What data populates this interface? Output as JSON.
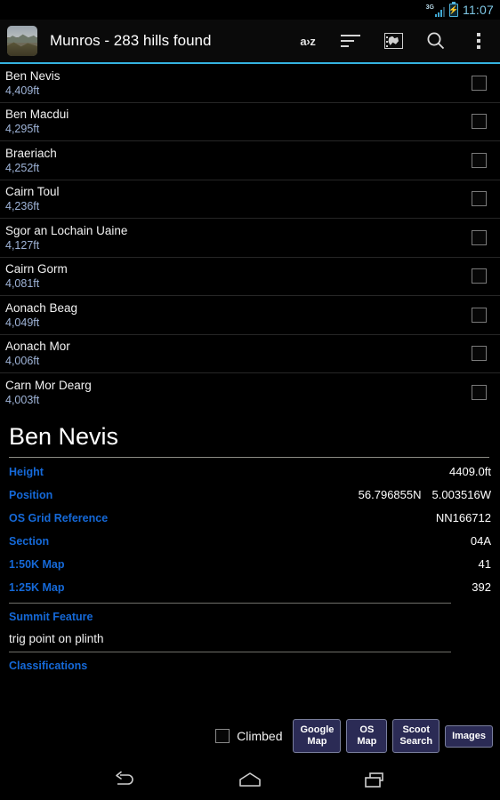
{
  "status_bar": {
    "network": "3G",
    "battery_icon": "battery-charging-icon",
    "time": "11:07"
  },
  "action_bar": {
    "logo_icon": "mountain-photo-logo",
    "title": "Munros - 283 hills found",
    "actions": [
      {
        "name": "sort-alpha-button",
        "label": "a›z"
      },
      {
        "name": "sort-order-button",
        "label": ""
      },
      {
        "name": "map-view-button",
        "label": ""
      },
      {
        "name": "search-button",
        "label": ""
      },
      {
        "name": "overflow-menu-button",
        "label": ""
      }
    ],
    "accent_color": "#34b3e0"
  },
  "hill_list": {
    "items": [
      {
        "name": "Ben Nevis",
        "height": "4,409ft"
      },
      {
        "name": "Ben Macdui",
        "height": "4,295ft"
      },
      {
        "name": "Braeriach",
        "height": "4,252ft"
      },
      {
        "name": "Cairn Toul",
        "height": "4,236ft"
      },
      {
        "name": "Sgor an Lochain Uaine",
        "height": "4,127ft"
      },
      {
        "name": "Cairn Gorm",
        "height": "4,081ft"
      },
      {
        "name": "Aonach Beag",
        "height": "4,049ft"
      },
      {
        "name": "Aonach Mor",
        "height": "4,006ft"
      },
      {
        "name": "Carn Mor Dearg",
        "height": "4,003ft"
      }
    ]
  },
  "detail": {
    "title": "Ben Nevis",
    "rows": [
      {
        "label": "Height",
        "value": "4409.0ft"
      },
      {
        "label": "Position",
        "value_lat": "56.796855N",
        "value_lon": "5.003516W"
      },
      {
        "label": "OS Grid Reference",
        "value": "NN166712"
      },
      {
        "label": "Section",
        "value": "04A"
      },
      {
        "label": "1:50K Map",
        "value": "41"
      },
      {
        "label": "1:25K Map",
        "value": "392"
      }
    ],
    "summit_feature_label": "Summit Feature",
    "summit_feature_value": "trig point on plinth",
    "classifications_label": "Classifications",
    "label_color": "#1569d8"
  },
  "bottom_bar": {
    "climbed_label": "Climbed",
    "climbed_checked": false,
    "buttons": [
      {
        "name": "google-map-button",
        "label": "Google\nMap"
      },
      {
        "name": "os-map-button",
        "label": "OS\nMap"
      },
      {
        "name": "scoot-search-button",
        "label": "Scoot\nSearch"
      },
      {
        "name": "images-button",
        "label": "Images"
      }
    ],
    "button_color": "#2b2b55"
  },
  "nav_bar": {
    "back_icon": "back-arrow-icon",
    "home_icon": "home-icon",
    "recents_icon": "recents-icon"
  }
}
